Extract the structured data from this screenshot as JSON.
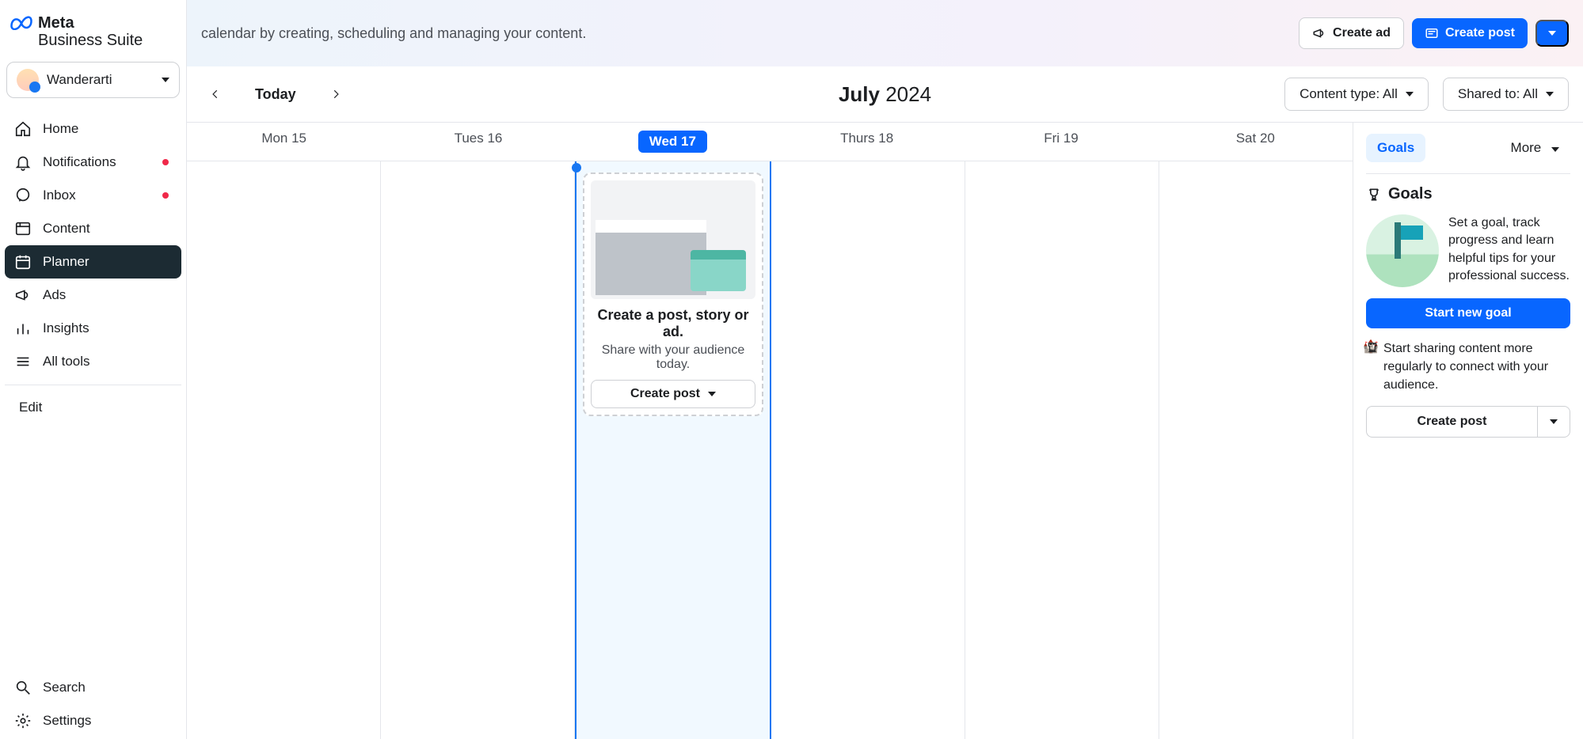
{
  "app_name_line1": "Meta",
  "app_name_line2": "Business Suite",
  "account_name": "Wanderarti",
  "sidebar": {
    "items": [
      {
        "label": "Home",
        "icon": "home-icon",
        "dot": false
      },
      {
        "label": "Notifications",
        "icon": "bell-icon",
        "dot": true
      },
      {
        "label": "Inbox",
        "icon": "chat-icon",
        "dot": true
      },
      {
        "label": "Content",
        "icon": "content-icon",
        "dot": false
      },
      {
        "label": "Planner",
        "icon": "calendar-icon",
        "dot": false,
        "active": true
      },
      {
        "label": "Ads",
        "icon": "megaphone-icon",
        "dot": false
      },
      {
        "label": "Insights",
        "icon": "bars-icon",
        "dot": false
      },
      {
        "label": "All tools",
        "icon": "menu-icon",
        "dot": false
      }
    ],
    "edit": "Edit",
    "search": "Search",
    "settings": "Settings"
  },
  "banner": {
    "text": "calendar by creating, scheduling and managing your content.",
    "create_ad": "Create ad",
    "create_post": "Create post"
  },
  "toolbar": {
    "today": "Today",
    "month": "July",
    "year": "2024",
    "filter_content": "Content type: All",
    "filter_shared": "Shared to: All"
  },
  "calendar": {
    "days": [
      "Mon 15",
      "Tues 16",
      "Wed 17",
      "Thurs 18",
      "Fri 19",
      "Sat 20"
    ],
    "active_index": 2,
    "card_title": "Create a post, story or ad.",
    "card_sub": "Share with your audience today.",
    "card_btn": "Create post"
  },
  "rpanel": {
    "tab_goals": "Goals",
    "tab_more": "More",
    "goals_title": "Goals",
    "goals_desc": "Set a goal, track progress and learn helpful tips for your professional success.",
    "start_goal": "Start new goal",
    "tip": "Start sharing content more regularly to connect with your audience.",
    "create_post": "Create post"
  }
}
